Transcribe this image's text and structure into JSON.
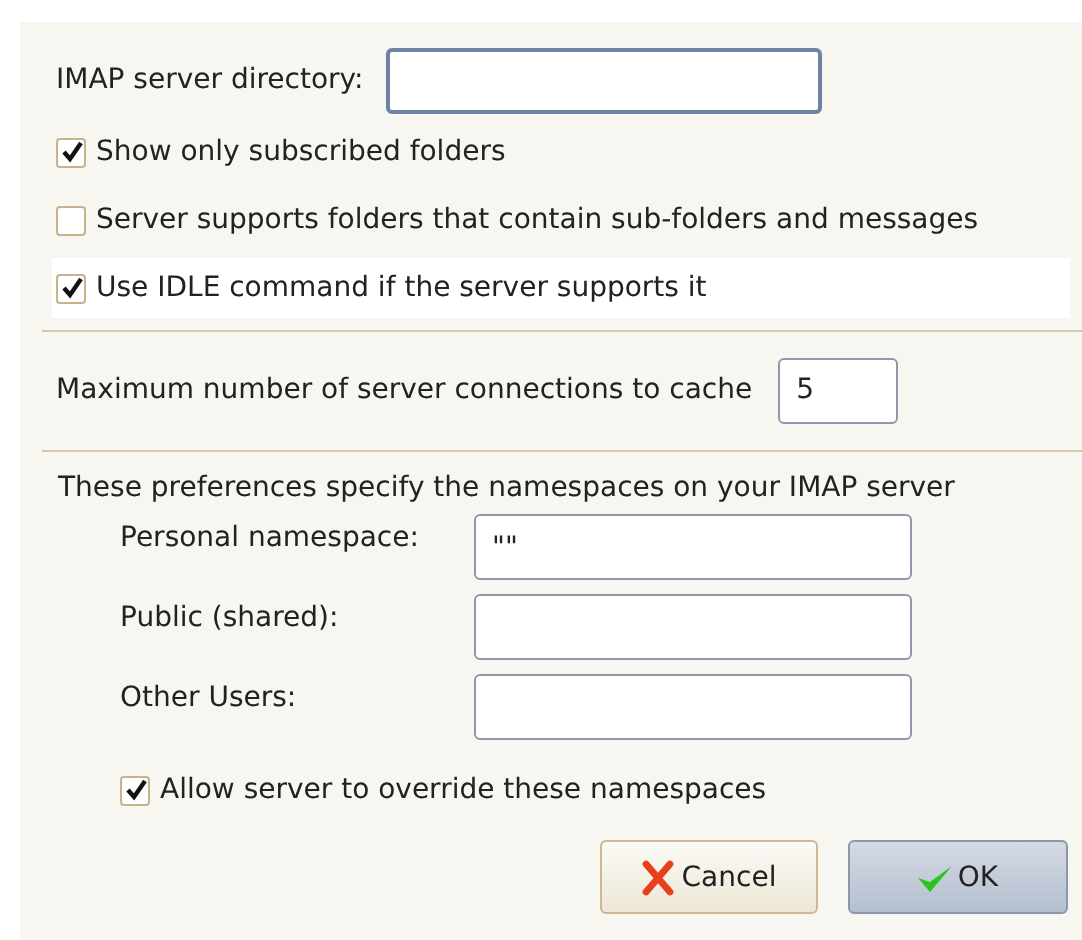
{
  "directory": {
    "label": "IMAP server directory:"
  },
  "options": [
    {
      "label": "Show only subscribed folders",
      "checked": true,
      "focused": false
    },
    {
      "label": "Server supports folders that contain sub-folders and messages",
      "checked": false,
      "focused": false
    },
    {
      "label": "Use IDLE command if the server supports it",
      "checked": true,
      "focused": true
    }
  ],
  "connections": {
    "label": "Maximum number of server connections to cache",
    "value": "5"
  },
  "namespaces": {
    "intro": "These preferences specify the namespaces on your IMAP server",
    "fields": [
      {
        "label": "Personal namespace:",
        "value": "\"\""
      },
      {
        "label": "Public (shared):"
      },
      {
        "label": "Other Users:"
      }
    ],
    "override": {
      "label": "Allow server to override these namespaces",
      "checked": true
    }
  },
  "buttons": [
    {
      "label": "Cancel",
      "kind": "cancel",
      "default": false
    },
    {
      "label": "OK",
      "kind": "ok",
      "default": true
    }
  ]
}
